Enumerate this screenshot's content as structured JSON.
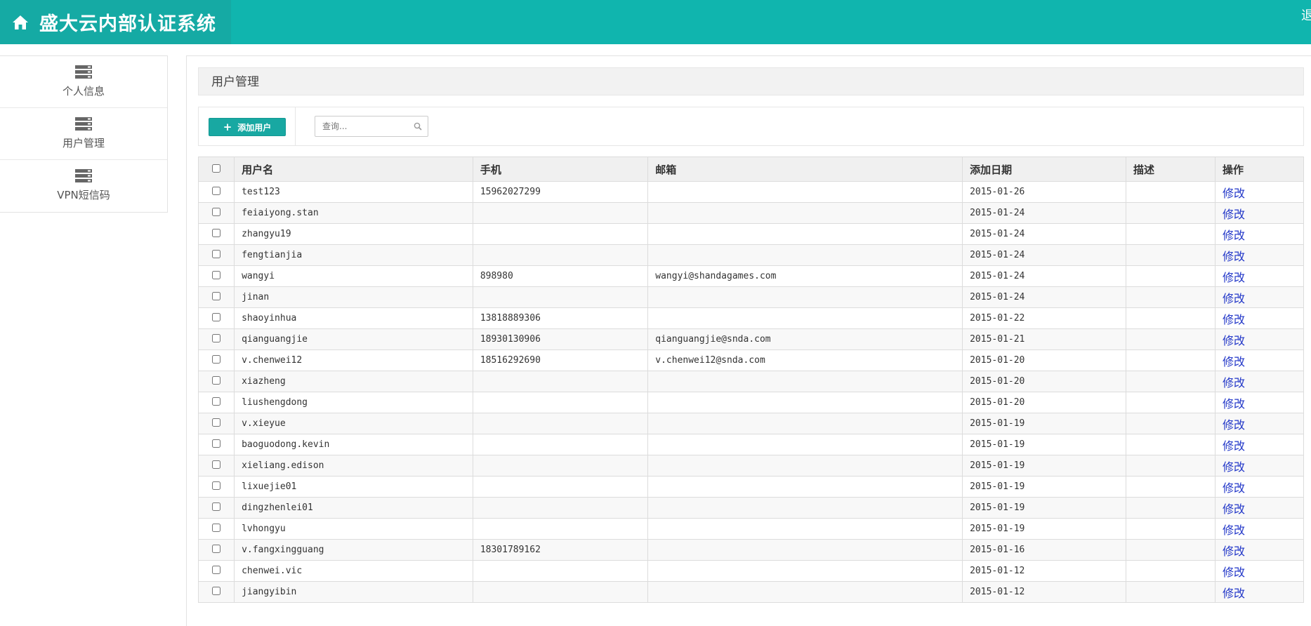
{
  "header": {
    "title": "盛大云内部认证系统",
    "logout_label": "退出",
    "home_icon": "home-icon",
    "bg_color": "#10b5ae"
  },
  "sidebar": {
    "items": [
      {
        "label": "个人信息",
        "icon": "server-icon"
      },
      {
        "label": "用户管理",
        "icon": "server-icon"
      },
      {
        "label": "VPN短信码",
        "icon": "server-icon"
      }
    ]
  },
  "main": {
    "section_title": "用户管理",
    "add_button_label": "添加用户",
    "search_placeholder": "查询...",
    "columns": [
      "用户名",
      "手机",
      "邮箱",
      "添加日期",
      "描述",
      "操作"
    ],
    "edit_label": "修改",
    "rows": [
      {
        "username": "test123",
        "phone": "15962027299",
        "email": "",
        "date": "2015-01-26",
        "desc": ""
      },
      {
        "username": "feiaiyong.stan",
        "phone": "",
        "email": "",
        "date": "2015-01-24",
        "desc": ""
      },
      {
        "username": "zhangyu19",
        "phone": "",
        "email": "",
        "date": "2015-01-24",
        "desc": ""
      },
      {
        "username": "fengtianjia",
        "phone": "",
        "email": "",
        "date": "2015-01-24",
        "desc": ""
      },
      {
        "username": "wangyi",
        "phone": "898980",
        "email": "wangyi@shandagames.com",
        "date": "2015-01-24",
        "desc": ""
      },
      {
        "username": "jinan",
        "phone": "",
        "email": "",
        "date": "2015-01-24",
        "desc": ""
      },
      {
        "username": "shaoyinhua",
        "phone": "13818889306",
        "email": "",
        "date": "2015-01-22",
        "desc": ""
      },
      {
        "username": "qianguangjie",
        "phone": "18930130906",
        "email": "qianguangjie@snda.com",
        "date": "2015-01-21",
        "desc": ""
      },
      {
        "username": "v.chenwei12",
        "phone": "18516292690",
        "email": "v.chenwei12@snda.com",
        "date": "2015-01-20",
        "desc": ""
      },
      {
        "username": "xiazheng",
        "phone": "",
        "email": "",
        "date": "2015-01-20",
        "desc": ""
      },
      {
        "username": "liushengdong",
        "phone": "",
        "email": "",
        "date": "2015-01-20",
        "desc": ""
      },
      {
        "username": "v.xieyue",
        "phone": "",
        "email": "",
        "date": "2015-01-19",
        "desc": ""
      },
      {
        "username": "baoguodong.kevin",
        "phone": "",
        "email": "",
        "date": "2015-01-19",
        "desc": ""
      },
      {
        "username": "xieliang.edison",
        "phone": "",
        "email": "",
        "date": "2015-01-19",
        "desc": ""
      },
      {
        "username": "lixuejie01",
        "phone": "",
        "email": "",
        "date": "2015-01-19",
        "desc": ""
      },
      {
        "username": "dingzhenlei01",
        "phone": "",
        "email": "",
        "date": "2015-01-19",
        "desc": ""
      },
      {
        "username": "lvhongyu",
        "phone": "",
        "email": "",
        "date": "2015-01-19",
        "desc": ""
      },
      {
        "username": "v.fangxingguang",
        "phone": "18301789162",
        "email": "",
        "date": "2015-01-16",
        "desc": ""
      },
      {
        "username": "chenwei.vic",
        "phone": "",
        "email": "",
        "date": "2015-01-12",
        "desc": ""
      },
      {
        "username": "jiangyibin",
        "phone": "",
        "email": "",
        "date": "2015-01-12",
        "desc": ""
      }
    ]
  }
}
